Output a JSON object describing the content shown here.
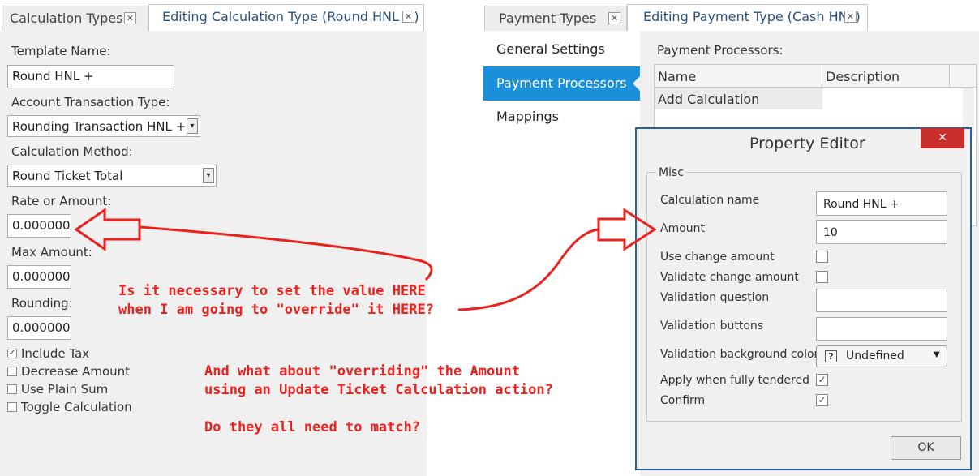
{
  "left_tabs": {
    "tab1": "Calculation Types",
    "tab2": "Editing Calculation Type (Round HNL +)",
    "close": "✕"
  },
  "left_form": {
    "template_name_label": "Template Name:",
    "template_name_value": "Round HNL +",
    "account_transaction_type_label": "Account Transaction Type:",
    "account_transaction_type_value": "Rounding Transaction HNL +",
    "calculation_method_label": "Calculation Method:",
    "calculation_method_value": "Round Ticket Total",
    "rate_label": "Rate or Amount:",
    "rate_value": "0.000000",
    "max_amount_label": "Max Amount:",
    "max_amount_value": "0.000000",
    "rounding_label": "Rounding:",
    "rounding_value": "0.000000",
    "include_tax": "Include Tax",
    "decrease_amount": "Decrease Amount",
    "use_plain_sum": "Use Plain Sum",
    "toggle_calculation": "Toggle Calculation",
    "check_mark": "✓",
    "dropdown_arrow": "▾"
  },
  "right_tabs": {
    "tab1": "Payment Types",
    "tab2": "Editing Payment Type (Cash HNL)",
    "close": "✕"
  },
  "side_menu": {
    "items": [
      "General Settings",
      "Payment Processors",
      "Mappings"
    ],
    "selected_index": 1
  },
  "processors": {
    "title": "Payment Processors:",
    "col_name": "Name",
    "col_description": "Description",
    "row1_name": "Add Calculation",
    "row1_description": ""
  },
  "property_editor": {
    "title": "Property Editor",
    "close": "✕",
    "group": "Misc",
    "calculation_name_label": "Calculation name",
    "calculation_name_value": "Round HNL +",
    "amount_label": "Amount",
    "amount_value": "10",
    "use_change_amount_label": "Use change amount",
    "validate_change_amount_label": "Validate change amount",
    "validation_question_label": "Validation question",
    "validation_buttons_label": "Validation buttons",
    "validation_bg_color_label": "Validation background color",
    "validation_bg_color_value": "Undefined",
    "validation_bg_color_icon": "?",
    "apply_when_fully_tendered_label": "Apply when fully tendered",
    "confirm_label": "Confirm",
    "check_mark": "✓",
    "dropdown_arrow": "▼",
    "ok_label": "OK"
  },
  "annotations": {
    "note1_line1": "Is it necessary to set the value HERE",
    "note1_line2": "when I am going to \"override\" it HERE?",
    "note2_line1": "And what about \"overriding\" the Amount",
    "note2_line2": "using an Update Ticket Calculation action?",
    "note3": "Do they all need to match?"
  },
  "colors": {
    "accent": "#1b8fd8",
    "annotation_red": "#e8221f",
    "close_button_red": "#c9302c",
    "dialog_border": "#2b5fa8"
  }
}
